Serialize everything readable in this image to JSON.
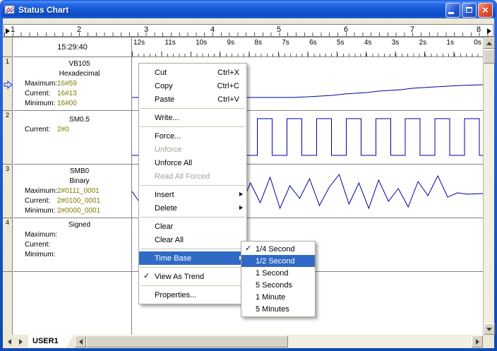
{
  "window": {
    "title": "Status Chart"
  },
  "ruler": {
    "marks": [
      "1",
      "2",
      "3",
      "4",
      "5",
      "6",
      "7",
      "8"
    ]
  },
  "chart": {
    "time_header": "15:29:40",
    "time_axis": [
      "12s",
      "11s",
      "10s",
      "9s",
      "8s",
      "7s",
      "6s",
      "5s",
      "4s",
      "3s",
      "2s",
      "1s",
      "0s"
    ],
    "rows": [
      {
        "num": "1",
        "name": "VB105",
        "format": "Hexadecimal",
        "lines": [
          {
            "label": "Maximum:",
            "value": "16#59"
          },
          {
            "label": "Current:",
            "value": "16#13"
          },
          {
            "label": "Minimum:",
            "value": "16#00"
          }
        ]
      },
      {
        "num": "2",
        "name": "SM0.5",
        "format": "",
        "lines": [
          {
            "label": "Current:",
            "value": "2#0"
          }
        ]
      },
      {
        "num": "3",
        "name": "SMB0",
        "format": "Binary",
        "lines": [
          {
            "label": "Maximum:",
            "value": "2#0111_0001"
          },
          {
            "label": "Current:",
            "value": "2#0100_0001"
          },
          {
            "label": "Minimum:",
            "value": "2#0000_0001"
          }
        ]
      },
      {
        "num": "4",
        "name": "",
        "format": "Signed",
        "lines": [
          {
            "label": "Maximum:",
            "value": ""
          },
          {
            "label": "Current:",
            "value": ""
          },
          {
            "label": "Minimum:",
            "value": ""
          }
        ]
      }
    ]
  },
  "tabs": {
    "user1": "USER1"
  },
  "context_menu": {
    "items": [
      {
        "label": "Cut",
        "shortcut": "Ctrl+X"
      },
      {
        "label": "Copy",
        "shortcut": "Ctrl+C"
      },
      {
        "label": "Paste",
        "shortcut": "Ctrl+V"
      },
      {
        "label": "Write..."
      },
      {
        "label": "Force..."
      },
      {
        "label": "Unforce",
        "disabled": true
      },
      {
        "label": "Unforce All"
      },
      {
        "label": "Read All Forced",
        "disabled": true
      },
      {
        "label": "Insert",
        "has_submenu": true
      },
      {
        "label": "Delete",
        "has_submenu": true
      },
      {
        "label": "Clear"
      },
      {
        "label": "Clear All"
      },
      {
        "label": "Time Base",
        "has_submenu": true,
        "highlighted": true
      },
      {
        "label": "View As Trend",
        "checked": true
      },
      {
        "label": "Properties..."
      }
    ]
  },
  "time_base_submenu": {
    "items": [
      {
        "label": "1/4 Second",
        "checked": true
      },
      {
        "label": "1/2 Second",
        "highlighted": true
      },
      {
        "label": "1 Second"
      },
      {
        "label": "5 Seconds"
      },
      {
        "label": "1 Minute"
      },
      {
        "label": "5 Minutes"
      }
    ]
  },
  "colors": {
    "value_text": "#7E7C00",
    "trend_line": "#0000A0",
    "menu_highlight": "#316AC5",
    "titlebar_blue": "#1658D8"
  }
}
